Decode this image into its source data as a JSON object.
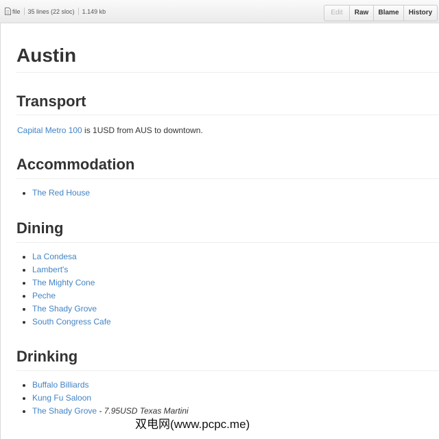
{
  "file_header": {
    "file_label": "file",
    "lines": "35 lines (22 sloc)",
    "size": "1.149 kb",
    "buttons": [
      "Edit",
      "Raw",
      "Blame",
      "History"
    ]
  },
  "document": {
    "title": "Austin",
    "transport": {
      "heading": "Transport",
      "link": "Capital Metro 100",
      "text": " is 1USD from AUS to downtown."
    },
    "accommodation": {
      "heading": "Accommodation",
      "items": [
        "The Red House"
      ]
    },
    "dining": {
      "heading": "Dining",
      "items": [
        "La Condesa",
        "Lambert's",
        "The Mighty Cone",
        "Peche",
        "The Shady Grove",
        "South Congress Cafe"
      ]
    },
    "drinking": {
      "heading": "Drinking",
      "items": [
        "Buffalo Billiards",
        "Kung Fu Saloon",
        "The Shady Grove"
      ],
      "last_note": " - 7.95USD Texas Martini"
    }
  },
  "watermark": "双电网(www.pcpc.me)",
  "colors": {
    "link": "#4183c4",
    "text": "#333333",
    "rule": "#eeeeee"
  }
}
